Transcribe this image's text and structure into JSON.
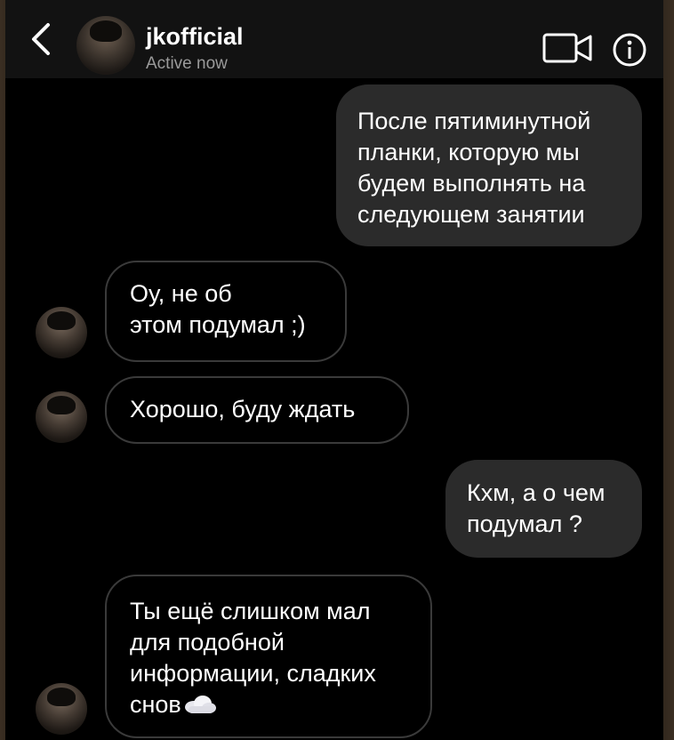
{
  "header": {
    "back_icon": "chevron-left-icon",
    "title": "jkofficial",
    "status": "Active now",
    "video_icon": "video-camera-icon",
    "info_icon": "info-icon"
  },
  "messages": [
    {
      "direction": "outgoing",
      "lines": [
        "После пятиминутной",
        "планки, которую мы",
        "будем выполнять на",
        "следующем занятии"
      ]
    },
    {
      "direction": "incoming",
      "lines": [
        "Оу, не об",
        "этом подумал ;)"
      ]
    },
    {
      "direction": "incoming",
      "lines": [
        "Хорошо, буду ждать"
      ]
    },
    {
      "direction": "outgoing",
      "lines": [
        "Кхм, а о чем",
        "подумал ?"
      ]
    },
    {
      "direction": "incoming",
      "lines": [
        "Ты ещё слишком мал",
        "для подобной",
        "информации, сладких",
        "снов"
      ],
      "emoji": "cloud-icon"
    }
  ],
  "colors": {
    "background": "#000000",
    "header": "#121212",
    "outgoing_bubble": "#2b2b2b",
    "incoming_border": "#3a3a3a",
    "text": "#ffffff",
    "status_text": "#9a9a9a"
  }
}
